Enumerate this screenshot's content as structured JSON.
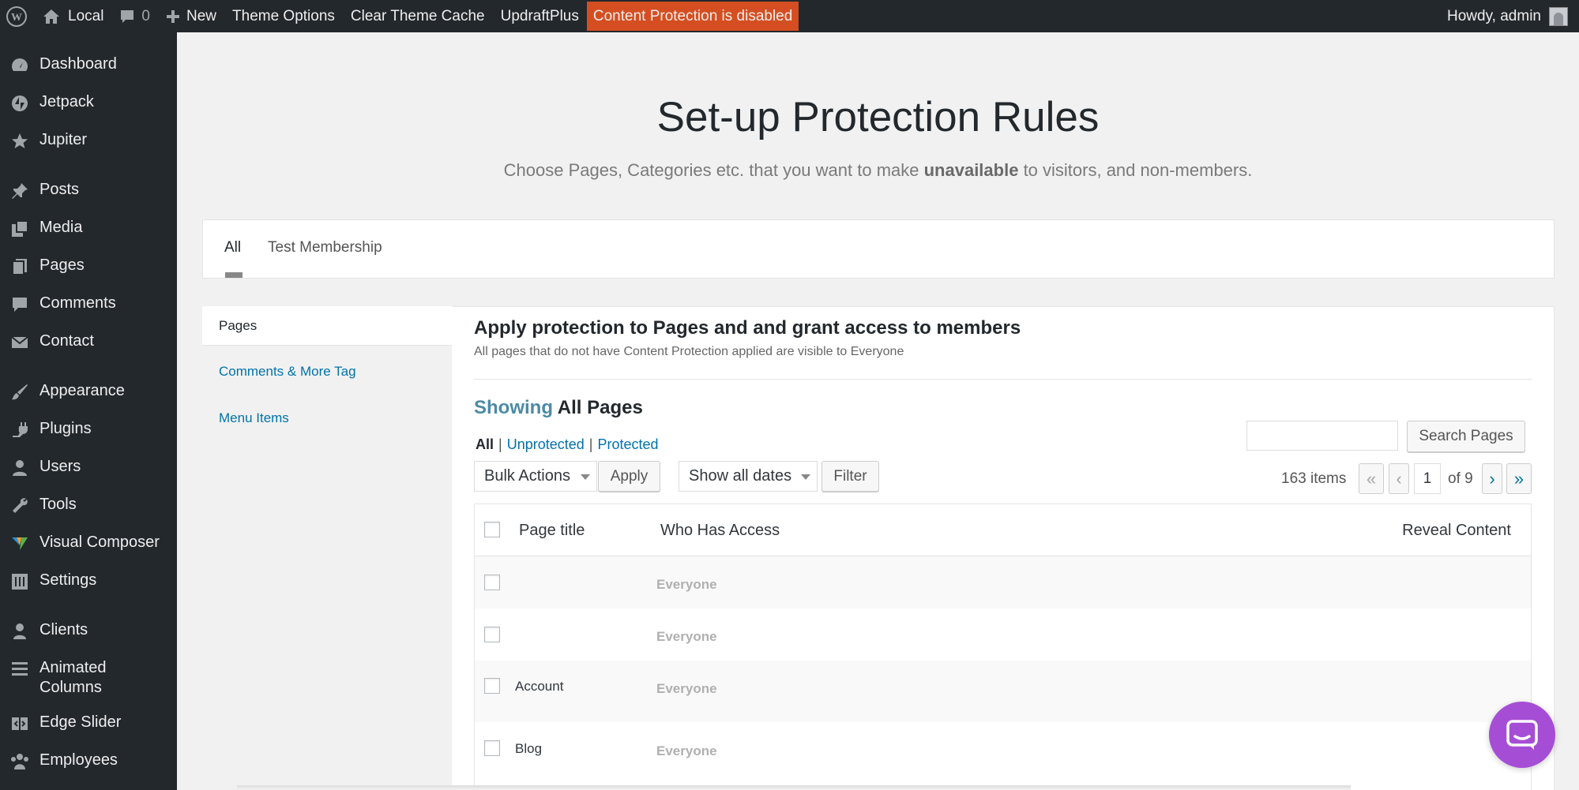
{
  "adminbar": {
    "site_name": "Local",
    "comments_count": "0",
    "new_label": "New",
    "theme_options": "Theme Options",
    "clear_cache": "Clear Theme Cache",
    "updraft": "UpdraftPlus",
    "protection_alert": "Content Protection is disabled",
    "howdy": "Howdy, admin",
    "alert_color": "#d54e21"
  },
  "sidebar": {
    "items": [
      {
        "label": "Dashboard",
        "icon": "dashboard-icon"
      },
      {
        "label": "Jetpack",
        "icon": "jetpack-icon"
      },
      {
        "label": "Jupiter",
        "icon": "star-icon"
      },
      {
        "label": "Posts",
        "icon": "pushpin-icon"
      },
      {
        "label": "Media",
        "icon": "media-icon"
      },
      {
        "label": "Pages",
        "icon": "pages-icon"
      },
      {
        "label": "Comments",
        "icon": "comment-icon"
      },
      {
        "label": "Contact",
        "icon": "envelope-icon"
      },
      {
        "label": "Appearance",
        "icon": "paintbrush-icon"
      },
      {
        "label": "Plugins",
        "icon": "plug-icon"
      },
      {
        "label": "Users",
        "icon": "user-icon"
      },
      {
        "label": "Tools",
        "icon": "wrench-icon"
      },
      {
        "label": "Visual Composer",
        "icon": "visual-composer-icon"
      },
      {
        "label": "Settings",
        "icon": "settings-icon"
      },
      {
        "label": "Clients",
        "icon": "clients-icon"
      },
      {
        "label": "Animated Columns",
        "icon": "columns-icon"
      },
      {
        "label": "Edge Slider",
        "icon": "slider-icon"
      },
      {
        "label": "Employees",
        "icon": "group-icon"
      }
    ]
  },
  "header": {
    "title": "Set-up Protection Rules",
    "subtitle_pre": "Choose Pages, Categories etc. that you want to make ",
    "subtitle_bold": "unavailable",
    "subtitle_post": " to visitors, and non-members."
  },
  "tabs": [
    {
      "label": "All",
      "active": true
    },
    {
      "label": "Test Membership",
      "active": false
    }
  ],
  "subnav": [
    {
      "label": "Pages",
      "active": true
    },
    {
      "label": "Comments & More Tag",
      "active": false
    },
    {
      "label": "Menu Items",
      "active": false
    }
  ],
  "section": {
    "title": "Apply protection to Pages and and grant access to members",
    "desc": "All pages that do not have Content Protection applied are visible to Everyone"
  },
  "showing": {
    "prefix": "Showing",
    "value": "All Pages"
  },
  "filters": {
    "all": "All",
    "unprotected": "Unprotected",
    "protected": "Protected",
    "separator": "|"
  },
  "toolbar": {
    "bulk_actions": "Bulk Actions",
    "apply": "Apply",
    "dates": "Show all dates",
    "filter": "Filter",
    "search_button": "Search Pages",
    "search_placeholder": ""
  },
  "pagination": {
    "items": "163 items",
    "current_page": "1",
    "of_label": "of 9",
    "first": "«",
    "prev": "‹",
    "next": "›",
    "last": "»"
  },
  "table": {
    "columns": [
      "Page title",
      "Who Has Access",
      "Reveal Content"
    ],
    "rows": [
      {
        "title": "",
        "access": "Everyone"
      },
      {
        "title": "",
        "access": "Everyone"
      },
      {
        "title": "Account",
        "access": "Everyone"
      },
      {
        "title": "Blog",
        "access": "Everyone"
      }
    ]
  },
  "colors": {
    "link": "#0073aa",
    "chat": "#a64dd6",
    "sidebar": "#23282d"
  }
}
